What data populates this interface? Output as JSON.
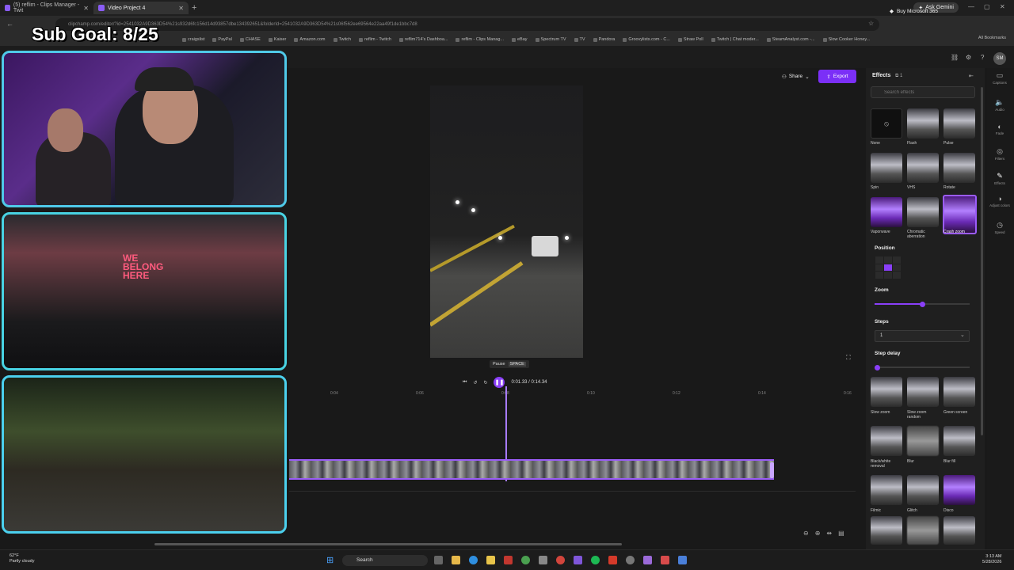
{
  "browser": {
    "tabs": [
      {
        "title": "(5) reflim - Clips Manager - Twit"
      },
      {
        "title": "Video Project 4"
      }
    ],
    "ask_gemini": "Ask Gemini",
    "url": "clipchamp.com/editor/?id=2541032A9D363D54%21s932d6fc156d14d93857dbe134392651&folderId=2541032A9D363D54%21s06f562ee69564e22aa49f1de1bbc7d8",
    "bookmarks": [
      "craigslist",
      "PayPal",
      "CHASE",
      "Kaiser",
      "Amazon.com",
      "Twitch",
      "reflim - Twitch",
      "reflim714's Dashboa...",
      "reflim - Clips Manag...",
      "eBay",
      "Spectrum TV",
      "TV",
      "Pandora",
      "Groovylists.com - C...",
      "Straw Poll",
      "Twitch | Chat moder...",
      "SteamAnalyst.com -...",
      "Slow Cooker Honey..."
    ],
    "all_bookmarks": "All Bookmarks"
  },
  "overlay": {
    "sub_goal": "Sub Goal: 8/25",
    "stage_sign": "WE BELONG HERE"
  },
  "app": {
    "buy_label": "Buy Microsoft 365",
    "avatar": "SM",
    "share_label": "Share",
    "export_label": "Export",
    "tooltip_label": "Pause",
    "tooltip_key": "SPACE",
    "current_time": "0:01.33",
    "total_time": "0:14.34",
    "timecode": "0:01.33 / 0:14.34",
    "ruler_ticks": [
      "0:04",
      "0:06",
      "0:08",
      "0:10",
      "0:12",
      "0:14",
      "0:16"
    ]
  },
  "effects": {
    "title": "Effects",
    "count": "1",
    "search_placeholder": "Search effects",
    "items": [
      {
        "label": "None"
      },
      {
        "label": "Flash"
      },
      {
        "label": "Pulse"
      },
      {
        "label": "Spin"
      },
      {
        "label": "VHS"
      },
      {
        "label": "Rotate"
      },
      {
        "label": "Vaporwave"
      },
      {
        "label": "Chromatic aberration"
      },
      {
        "label": "Crash zoom"
      }
    ],
    "position_label": "Position",
    "zoom_label": "Zoom",
    "zoom_value": 0.5,
    "steps_label": "Steps",
    "steps_value": "1",
    "step_delay_label": "Step delay",
    "lower_items": [
      {
        "label": "Slow zoom"
      },
      {
        "label": "Slow zoom random"
      },
      {
        "label": "Green screen"
      },
      {
        "label": "Black/white removal"
      },
      {
        "label": "Blur"
      },
      {
        "label": "Blur fill"
      },
      {
        "label": "Filmic"
      },
      {
        "label": "Glitch"
      },
      {
        "label": "Disco"
      }
    ]
  },
  "rail": [
    "Captions",
    "Audio",
    "Fade",
    "Filters",
    "Effects",
    "Adjust colors",
    "Speed"
  ],
  "taskbar": {
    "temp": "62°F",
    "weather": "Partly cloudy",
    "search": "Search",
    "time": "3:13 AM",
    "date": "5/28/2026"
  },
  "colors": {
    "accent": "#8a3ff8",
    "cam_border": "#4fc9e8"
  }
}
